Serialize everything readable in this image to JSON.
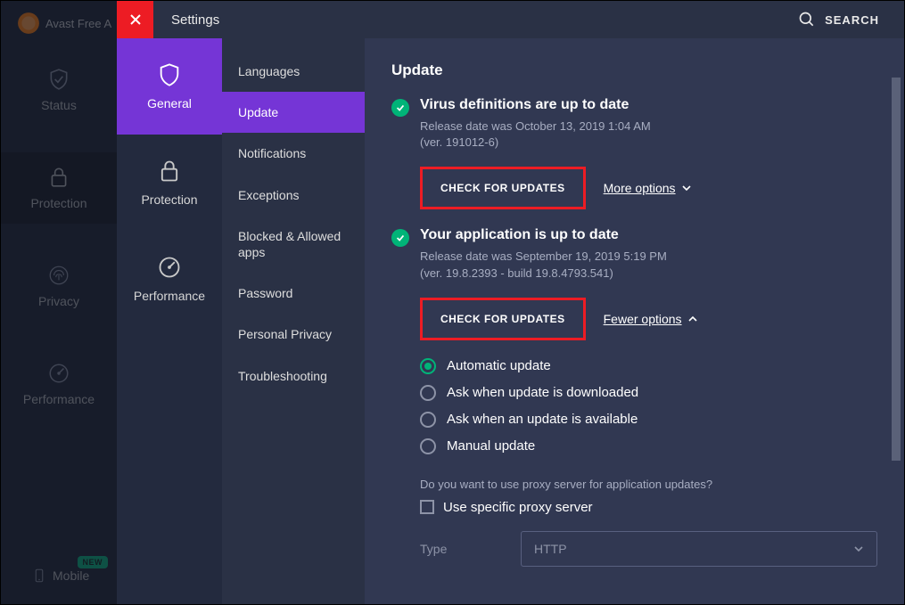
{
  "app_title_partial": "Avast Free A",
  "header": {
    "title": "Settings",
    "search_label": "SEARCH"
  },
  "leftnav": {
    "status": "Status",
    "protection": "Protection",
    "privacy": "Privacy",
    "performance": "Performance",
    "mobile": "Mobile",
    "new_badge": "NEW"
  },
  "settings_tabs": {
    "general": "General",
    "protection": "Protection",
    "performance": "Performance"
  },
  "sublist": {
    "languages": "Languages",
    "update": "Update",
    "notifications": "Notifications",
    "exceptions": "Exceptions",
    "blocked_allowed": "Blocked & Allowed apps",
    "password": "Password",
    "personal_privacy": "Personal Privacy",
    "troubleshooting": "Troubleshooting"
  },
  "page": {
    "heading": "Update",
    "virus": {
      "title": "Virus definitions are up to date",
      "release": "Release date was October 13, 2019 1:04 AM",
      "ver": "(ver. 191012-6)",
      "check_btn": "CHECK FOR UPDATES",
      "options_link": "More options"
    },
    "app": {
      "title": "Your application is up to date",
      "release": "Release date was September 19, 2019 5:19 PM",
      "ver": "(ver. 19.8.2393 - build 19.8.4793.541)",
      "check_btn": "CHECK FOR UPDATES",
      "options_link": "Fewer options",
      "radios": {
        "auto": "Automatic update",
        "ask_downloaded": "Ask when update is downloaded",
        "ask_available": "Ask when an update is available",
        "manual": "Manual update"
      },
      "proxy_q": "Do you want to use proxy server for application updates?",
      "proxy_checkbox": "Use specific proxy server",
      "type_label": "Type",
      "type_value": "HTTP"
    }
  }
}
